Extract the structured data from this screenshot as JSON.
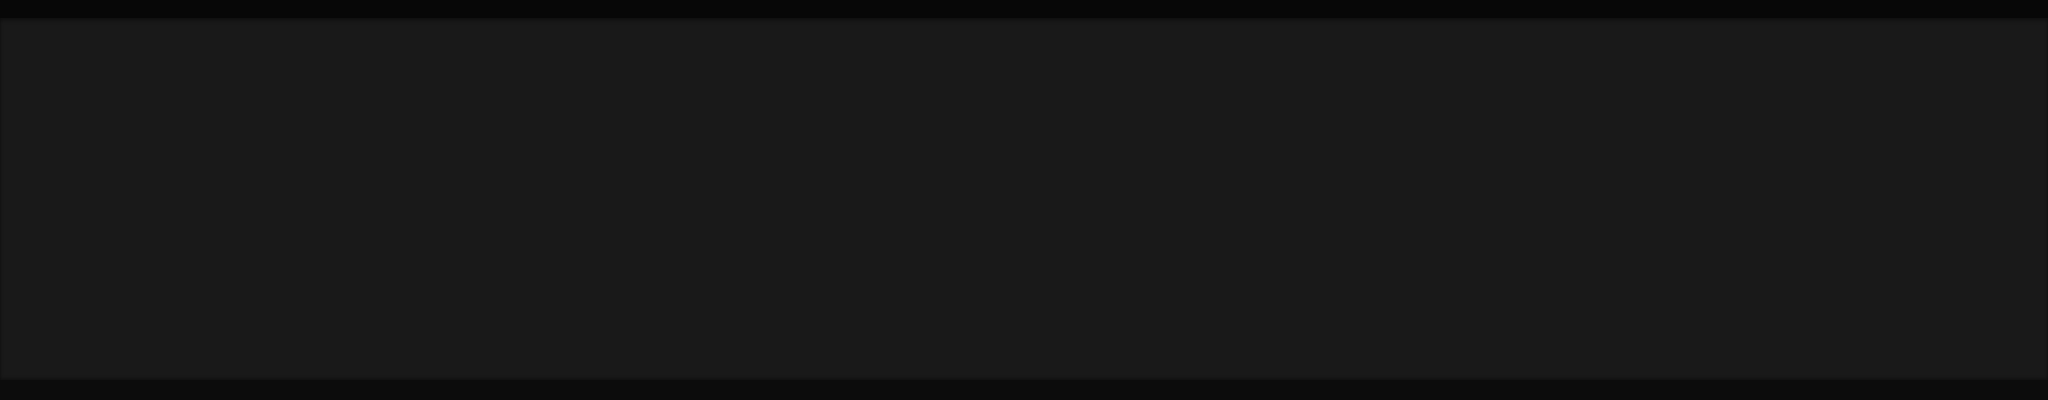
{
  "screen": {
    "colors": {
      "top_bar": "#070707",
      "main_panel": "#191919",
      "bottom_bar": "#0c0c0c"
    }
  }
}
